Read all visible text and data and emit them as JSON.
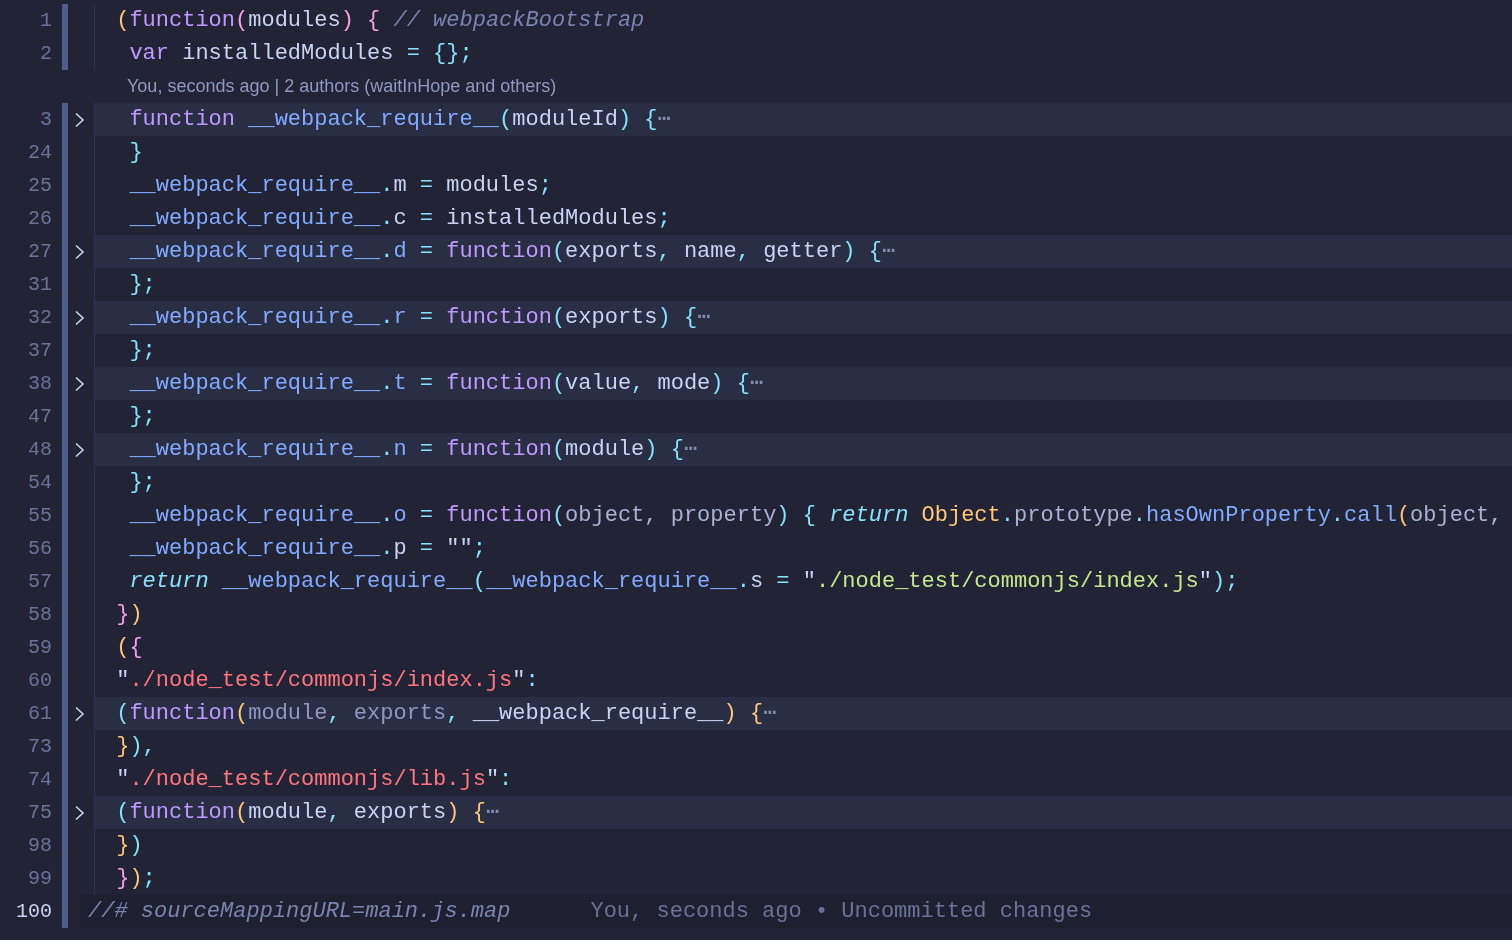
{
  "editor": {
    "lines": [
      {
        "number": "1",
        "folded": false,
        "current": false,
        "changed": true,
        "tokens": [
          {
            "text": " (",
            "kind": "by"
          },
          {
            "text": "function",
            "kind": "kw"
          },
          {
            "text": "(",
            "kind": "bp"
          },
          {
            "text": "modules",
            "kind": "var"
          },
          {
            "text": ")",
            "kind": "bp"
          },
          {
            "text": " {",
            "kind": "bp"
          },
          {
            "text": " // webpackBootstrap",
            "kind": "cmt"
          }
        ]
      },
      {
        "number": "2",
        "folded": false,
        "current": false,
        "changed": true,
        "tokens": [
          {
            "text": "  var",
            "kind": "kw"
          },
          {
            "text": " installedModules ",
            "kind": "var"
          },
          {
            "text": "= {};",
            "kind": "punct"
          }
        ],
        "blame_hint": "You, seconds ago | 2 authors (waitInHope and others)"
      },
      {
        "number": "3",
        "folded": true,
        "current": false,
        "changed": true,
        "tokens": [
          {
            "text": "  function",
            "kind": "kw"
          },
          {
            "text": " __webpack_require__",
            "kind": "fn"
          },
          {
            "text": "(",
            "kind": "punct"
          },
          {
            "text": "moduleId",
            "kind": "var"
          },
          {
            "text": ") {",
            "kind": "punct"
          },
          {
            "text": "⋯",
            "kind": "fold"
          }
        ]
      },
      {
        "number": "24",
        "folded": false,
        "current": false,
        "changed": true,
        "tokens": [
          {
            "text": "  }",
            "kind": "punct"
          }
        ]
      },
      {
        "number": "25",
        "folded": false,
        "current": false,
        "changed": true,
        "tokens": [
          {
            "text": "  __webpack_require__",
            "kind": "fn"
          },
          {
            "text": ".",
            "kind": "punct"
          },
          {
            "text": "m",
            "kind": "var"
          },
          {
            "text": " = ",
            "kind": "punct"
          },
          {
            "text": "modules",
            "kind": "var"
          },
          {
            "text": ";",
            "kind": "punct"
          }
        ]
      },
      {
        "number": "26",
        "folded": false,
        "current": false,
        "changed": true,
        "tokens": [
          {
            "text": "  __webpack_require__",
            "kind": "fn"
          },
          {
            "text": ".",
            "kind": "punct"
          },
          {
            "text": "c",
            "kind": "var"
          },
          {
            "text": " = ",
            "kind": "punct"
          },
          {
            "text": "installedModules",
            "kind": "var"
          },
          {
            "text": ";",
            "kind": "punct"
          }
        ]
      },
      {
        "number": "27",
        "folded": true,
        "current": false,
        "changed": true,
        "tokens": [
          {
            "text": "  __webpack_require__",
            "kind": "fn"
          },
          {
            "text": ".",
            "kind": "punct"
          },
          {
            "text": "d",
            "kind": "fn"
          },
          {
            "text": " = ",
            "kind": "punct"
          },
          {
            "text": "function",
            "kind": "kw"
          },
          {
            "text": "(",
            "kind": "punct"
          },
          {
            "text": "exports",
            "kind": "var"
          },
          {
            "text": ", ",
            "kind": "punct"
          },
          {
            "text": "name",
            "kind": "var"
          },
          {
            "text": ", ",
            "kind": "punct"
          },
          {
            "text": "getter",
            "kind": "var"
          },
          {
            "text": ") {",
            "kind": "punct"
          },
          {
            "text": "⋯",
            "kind": "fold"
          }
        ]
      },
      {
        "number": "31",
        "folded": false,
        "current": false,
        "changed": true,
        "tokens": [
          {
            "text": "  };",
            "kind": "punct"
          }
        ]
      },
      {
        "number": "32",
        "folded": true,
        "current": false,
        "changed": true,
        "tokens": [
          {
            "text": "  __webpack_require__",
            "kind": "fn"
          },
          {
            "text": ".",
            "kind": "punct"
          },
          {
            "text": "r",
            "kind": "fn"
          },
          {
            "text": " = ",
            "kind": "punct"
          },
          {
            "text": "function",
            "kind": "kw"
          },
          {
            "text": "(",
            "kind": "punct"
          },
          {
            "text": "exports",
            "kind": "var"
          },
          {
            "text": ") {",
            "kind": "punct"
          },
          {
            "text": "⋯",
            "kind": "fold"
          }
        ]
      },
      {
        "number": "37",
        "folded": false,
        "current": false,
        "changed": true,
        "tokens": [
          {
            "text": "  };",
            "kind": "punct"
          }
        ]
      },
      {
        "number": "38",
        "folded": true,
        "current": false,
        "changed": true,
        "tokens": [
          {
            "text": "  __webpack_require__",
            "kind": "fn"
          },
          {
            "text": ".",
            "kind": "punct"
          },
          {
            "text": "t",
            "kind": "fn"
          },
          {
            "text": " = ",
            "kind": "punct"
          },
          {
            "text": "function",
            "kind": "kw"
          },
          {
            "text": "(",
            "kind": "punct"
          },
          {
            "text": "value",
            "kind": "var"
          },
          {
            "text": ", ",
            "kind": "punct"
          },
          {
            "text": "mode",
            "kind": "var"
          },
          {
            "text": ") {",
            "kind": "punct"
          },
          {
            "text": "⋯",
            "kind": "fold"
          }
        ]
      },
      {
        "number": "47",
        "folded": false,
        "current": false,
        "changed": true,
        "tokens": [
          {
            "text": "  };",
            "kind": "punct"
          }
        ]
      },
      {
        "number": "48",
        "folded": true,
        "current": false,
        "changed": true,
        "tokens": [
          {
            "text": "  __webpack_require__",
            "kind": "fn"
          },
          {
            "text": ".",
            "kind": "punct"
          },
          {
            "text": "n",
            "kind": "fn"
          },
          {
            "text": " = ",
            "kind": "punct"
          },
          {
            "text": "function",
            "kind": "kw"
          },
          {
            "text": "(",
            "kind": "punct"
          },
          {
            "text": "module",
            "kind": "var"
          },
          {
            "text": ") {",
            "kind": "punct"
          },
          {
            "text": "⋯",
            "kind": "fold"
          }
        ]
      },
      {
        "number": "54",
        "folded": false,
        "current": false,
        "changed": true,
        "tokens": [
          {
            "text": "  };",
            "kind": "punct"
          }
        ]
      },
      {
        "number": "55",
        "folded": false,
        "current": false,
        "changed": true,
        "tokens": [
          {
            "text": "  __webpack_require__",
            "kind": "fn"
          },
          {
            "text": ".",
            "kind": "punct"
          },
          {
            "text": "o",
            "kind": "fn"
          },
          {
            "text": " = ",
            "kind": "punct"
          },
          {
            "text": "function",
            "kind": "kw"
          },
          {
            "text": "(",
            "kind": "punct"
          },
          {
            "text": "object, property",
            "kind": "param"
          },
          {
            "text": ") { ",
            "kind": "punct"
          },
          {
            "text": "return",
            "kind": "ret"
          },
          {
            "text": " Object",
            "kind": "obj"
          },
          {
            "text": ".",
            "kind": "punct"
          },
          {
            "text": "prototype",
            "kind": "param"
          },
          {
            "text": ".",
            "kind": "punct"
          },
          {
            "text": "hasOwnProperty",
            "kind": "fn"
          },
          {
            "text": ".",
            "kind": "punct"
          },
          {
            "text": "call",
            "kind": "fn"
          },
          {
            "text": "(",
            "kind": "by"
          },
          {
            "text": "object,",
            "kind": "param"
          }
        ]
      },
      {
        "number": "56",
        "folded": false,
        "current": false,
        "changed": true,
        "tokens": [
          {
            "text": "  __webpack_require__",
            "kind": "fn"
          },
          {
            "text": ".",
            "kind": "punct"
          },
          {
            "text": "p",
            "kind": "var"
          },
          {
            "text": " = ",
            "kind": "punct"
          },
          {
            "text": "\"\"",
            "kind": "var"
          },
          {
            "text": ";",
            "kind": "punct"
          }
        ]
      },
      {
        "number": "57",
        "folded": false,
        "current": false,
        "changed": true,
        "tokens": [
          {
            "text": "  return",
            "kind": "ret"
          },
          {
            "text": " __webpack_require__",
            "kind": "fn"
          },
          {
            "text": "(",
            "kind": "punct"
          },
          {
            "text": "__webpack_require__",
            "kind": "fn"
          },
          {
            "text": ".",
            "kind": "punct"
          },
          {
            "text": "s",
            "kind": "var"
          },
          {
            "text": " = ",
            "kind": "punct"
          },
          {
            "text": "\"",
            "kind": "var"
          },
          {
            "text": "./node_test/commonjs/index.js",
            "kind": "str"
          },
          {
            "text": "\"",
            "kind": "var"
          },
          {
            "text": ");",
            "kind": "punct"
          }
        ]
      },
      {
        "number": "58",
        "folded": false,
        "current": false,
        "changed": true,
        "tokens": [
          {
            "text": " }",
            "kind": "bp"
          },
          {
            "text": ")",
            "kind": "by"
          }
        ]
      },
      {
        "number": "59",
        "folded": false,
        "current": false,
        "changed": true,
        "tokens": [
          {
            "text": " (",
            "kind": "by"
          },
          {
            "text": "{",
            "kind": "bp"
          }
        ]
      },
      {
        "number": "60",
        "folded": false,
        "current": false,
        "changed": true,
        "tokens": [
          {
            "text": " \"",
            "kind": "var"
          },
          {
            "text": "./node_test/commonjs/index.js",
            "kind": "key"
          },
          {
            "text": "\"",
            "kind": "var"
          },
          {
            "text": ":",
            "kind": "punct"
          }
        ]
      },
      {
        "number": "61",
        "folded": true,
        "current": false,
        "changed": true,
        "tokens": [
          {
            "text": " (",
            "kind": "punct"
          },
          {
            "text": "function",
            "kind": "kw"
          },
          {
            "text": "(",
            "kind": "by"
          },
          {
            "text": "module",
            "kind": "dim"
          },
          {
            "text": ", ",
            "kind": "punct"
          },
          {
            "text": "exports",
            "kind": "dim"
          },
          {
            "text": ", ",
            "kind": "punct"
          },
          {
            "text": "__webpack_require__",
            "kind": "var"
          },
          {
            "text": ")",
            "kind": "by"
          },
          {
            "text": " {",
            "kind": "by"
          },
          {
            "text": "⋯",
            "kind": "fold"
          }
        ]
      },
      {
        "number": "73",
        "folded": false,
        "current": false,
        "changed": true,
        "tokens": [
          {
            "text": " }",
            "kind": "by"
          },
          {
            "text": "),",
            "kind": "punct"
          }
        ]
      },
      {
        "number": "74",
        "folded": false,
        "current": false,
        "changed": true,
        "tokens": [
          {
            "text": " \"",
            "kind": "var"
          },
          {
            "text": "./node_test/commonjs/lib.js",
            "kind": "key"
          },
          {
            "text": "\"",
            "kind": "var"
          },
          {
            "text": ":",
            "kind": "punct"
          }
        ]
      },
      {
        "number": "75",
        "folded": true,
        "current": false,
        "changed": true,
        "tokens": [
          {
            "text": " (",
            "kind": "punct"
          },
          {
            "text": "function",
            "kind": "kw"
          },
          {
            "text": "(",
            "kind": "by"
          },
          {
            "text": "module",
            "kind": "var"
          },
          {
            "text": ", ",
            "kind": "punct"
          },
          {
            "text": "exports",
            "kind": "var"
          },
          {
            "text": ")",
            "kind": "by"
          },
          {
            "text": " {",
            "kind": "by"
          },
          {
            "text": "⋯",
            "kind": "fold"
          }
        ]
      },
      {
        "number": "98",
        "folded": false,
        "current": false,
        "changed": true,
        "tokens": [
          {
            "text": " }",
            "kind": "by"
          },
          {
            "text": ")",
            "kind": "punct"
          }
        ]
      },
      {
        "number": "99",
        "folded": false,
        "current": false,
        "changed": true,
        "tokens": [
          {
            "text": " }",
            "kind": "bp"
          },
          {
            "text": ")",
            "kind": "by"
          },
          {
            "text": ";",
            "kind": "punct"
          }
        ]
      },
      {
        "number": "100",
        "folded": false,
        "current": true,
        "changed": true,
        "tokens": [
          {
            "text": "//# sourceMappingURL=main.js.map",
            "kind": "cmt"
          }
        ],
        "inline_blame": "You, seconds ago • Uncommitted changes"
      }
    ]
  }
}
